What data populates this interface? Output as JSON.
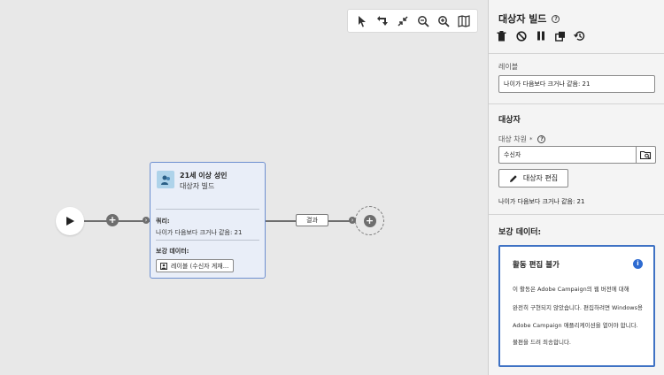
{
  "toolbar": {
    "buttons": [
      "select-icon",
      "rotate-icon",
      "collapse-icon",
      "zoom-out-icon",
      "zoom-in-icon",
      "map-icon"
    ]
  },
  "workflow": {
    "node": {
      "title": "21세 이상 성인",
      "subtitle": "대상자 빌드",
      "query_label": "쿼리:",
      "query_text": "나이가 다음보다 크거나 같음: 21",
      "supplement_label": "보강 데이터:",
      "chip_text": "레이블 (수신자 게재..."
    },
    "result_label": "결과"
  },
  "panel": {
    "title": "대상자 빌드",
    "label_section": {
      "label": "레이블",
      "value": "나이가 다음보다 크거나 같음: 21"
    },
    "audience_section": {
      "heading": "대상자",
      "dimension_label": "대상 차원",
      "required_mark": "*",
      "dimension_value": "수신자",
      "edit_button": "대상자 편집",
      "summary": "나이가 다음보다 크거나 같음: 21"
    },
    "enrichment_section": {
      "heading": "보강 데이터:",
      "alert_title": "활동 편집 불가",
      "alert_lines": [
        "이 활동은 Adobe Campaign의 웹 버전에 대해",
        "완전히 구현되지 않았습니다. 편집하려면 Windows용",
        "Adobe Campaign 애플리케이션을 열어야 합니다.",
        "불편을 드려 죄송합니다."
      ]
    }
  }
}
